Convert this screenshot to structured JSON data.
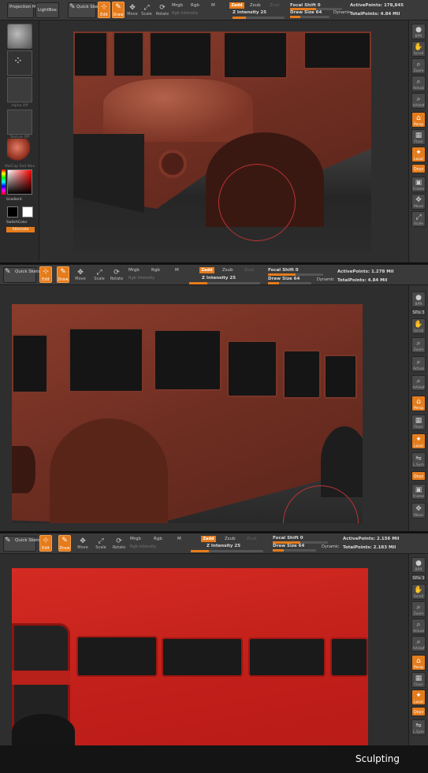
{
  "top_toolbar": {
    "projection_master": "Projection Master",
    "lightbox": "LightBox",
    "quick_sketch": "Quick Sketch",
    "edit": "Edit",
    "draw": "Draw",
    "move": "Move",
    "scale": "Scale",
    "rotate": "Rotate",
    "mrgb": "Mrgb",
    "rgb": "Rgb",
    "m": "M",
    "rgb_intensity": "Rgb Intensity",
    "zadd": "Zadd",
    "zsub": "Zsub",
    "zcut": "Zcut",
    "z_intensity": "Z Intensity 25",
    "focal_shift": "Focal Shift 0",
    "draw_size": "Draw Size 64",
    "dynamic": "Dynamic"
  },
  "panels": [
    {
      "active_points": "ActivePoints: 178,845",
      "total_points": "TotalPoints: 4.84 Mil"
    },
    {
      "active_points": "ActivePoints: 1.278 Mil",
      "total_points": "TotalPoints: 4.84 Mil"
    },
    {
      "active_points": "ActivePoints: 2.156 Mil",
      "total_points": "TotalPoints: 2.183 Mil"
    }
  ],
  "sliders": {
    "z_intensity": 0.25,
    "focal_shift": 0.5,
    "draw_size": 0.25
  },
  "left_shelf": {
    "alpha_label": "Alpha Off",
    "texture_label": "Texture Off",
    "material_label": "MatCap Red Wax",
    "gradient": "Gradient",
    "switch_color": "SwitchColor",
    "alternate": "Alternate"
  },
  "right_shelf": {
    "bpr": "BPR",
    "spix": "SPix 3",
    "scroll": "Scroll",
    "zoom": "Zoom",
    "actual": "Actual",
    "aahalf": "AAHalf",
    "persp": "Persp",
    "floor": "Floor",
    "local": "Local",
    "lsym": "L.Sym",
    "xyz": "Qxyz",
    "frame": "Frame",
    "move": "Move",
    "scale": "Scale"
  },
  "caption": "Sculpting",
  "colors": {
    "accent": "#e57c1c",
    "clay": "#8a3d2c",
    "paint": "#c81f1b"
  }
}
